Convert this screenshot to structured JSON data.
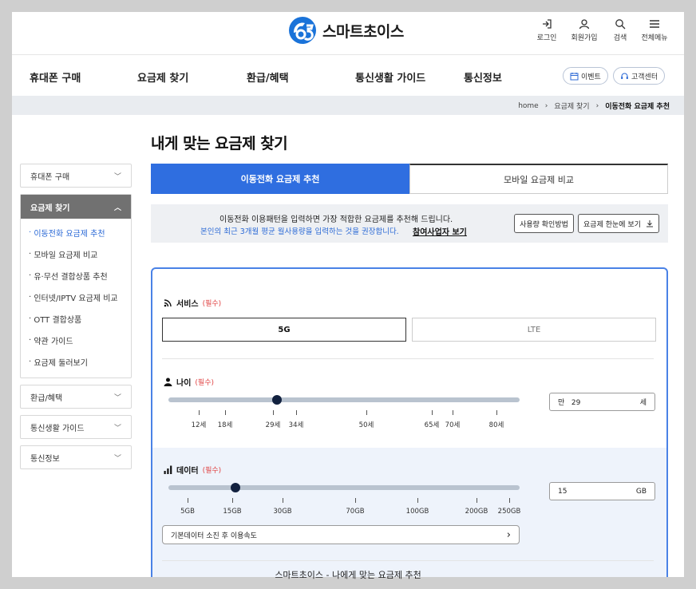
{
  "header": {
    "logo_text": "스마트초이스",
    "utils": [
      {
        "label": "로그인",
        "icon": "login-icon"
      },
      {
        "label": "회원가입",
        "icon": "user-icon"
      },
      {
        "label": "검색",
        "icon": "search-icon"
      },
      {
        "label": "전체메뉴",
        "icon": "menu-icon"
      }
    ]
  },
  "gnb": {
    "items": [
      "휴대폰 구매",
      "요금제 찾기",
      "환급/혜택",
      "통신생활 가이드",
      "통신정보"
    ],
    "event_label": "이벤트",
    "support_label": "고객센터"
  },
  "breadcrumb": [
    "home",
    "요금제 찾기",
    "이동전화 요금제 추천"
  ],
  "page_title": "내게 맞는 요금제 찾기",
  "sidebar": {
    "phone": "휴대폰 구매",
    "plan": "요금제 찾기",
    "plan_sub": [
      "이동전화 요금제 추천",
      "모바일 요금제 비교",
      "유·무선 결합상품 추천",
      "인터넷/IPTV 요금제 비교",
      "OTT 결합상품",
      "약관 가이드",
      "요금제 둘러보기"
    ],
    "refund": "환급/혜택",
    "guide": "통신생활 가이드",
    "info": "통신정보"
  },
  "tabs": [
    "이동전화 요금제 추천",
    "모바일 요금제 비교"
  ],
  "notice": {
    "line1": "이동전화 이용패턴을 입력하면 가장 적합한 요금제를 추천해 드립니다.",
    "line2": "본인의 최근 3개월 평균 월사용량을 입력하는 것을 권장합니다.",
    "link": "참여사업자 보기",
    "usage_btn": "사용량 확인방법",
    "view_btn": "요금제 한눈에 보기"
  },
  "form": {
    "service": {
      "label": "서비스",
      "required": "(필수)",
      "options": [
        "5G",
        "LTE"
      ],
      "selected": "5G"
    },
    "age": {
      "label": "나이",
      "required": "(필수)",
      "ticks": [
        "12세",
        "18세",
        "29세",
        "34세",
        "50세",
        "65세",
        "70세",
        "80세"
      ],
      "prefix": "만",
      "value": "29",
      "unit": "세",
      "level": 0.31
    },
    "data": {
      "label": "데이터",
      "required": "(필수)",
      "ticks": [
        "5GB",
        "15GB",
        "30GB",
        "70GB",
        "100GB",
        "200GB",
        "250GB"
      ],
      "value": "15",
      "unit": "GB",
      "level": 0.19,
      "speed_label": "기본데이터 소진 후 이용속도"
    }
  },
  "caption": "스마트초이스 - 나에게 맞는 요금제 추천",
  "colors": {
    "primary": "#2f6ee0",
    "required": "#e04444",
    "link": "#2c6ad6"
  }
}
